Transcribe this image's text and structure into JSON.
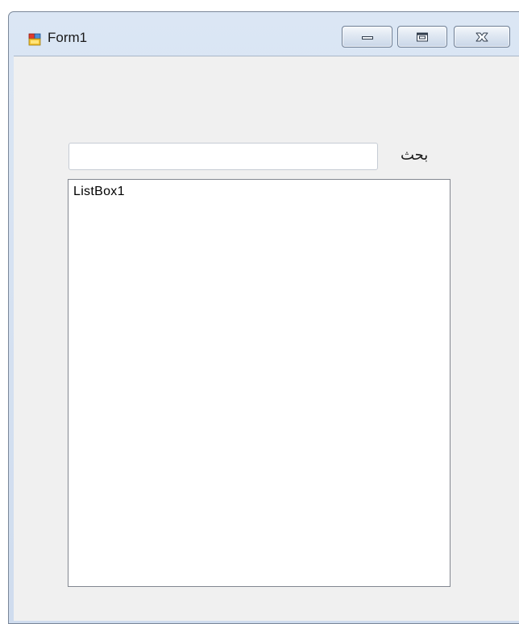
{
  "window": {
    "title": "Form1"
  },
  "controls": {
    "minimize_icon": "minimize-icon",
    "maximize_icon": "maximize-icon",
    "close_icon": "close-icon"
  },
  "search": {
    "label": "بحث",
    "value": "",
    "placeholder": ""
  },
  "listbox": {
    "items": [
      "ListBox1"
    ]
  }
}
